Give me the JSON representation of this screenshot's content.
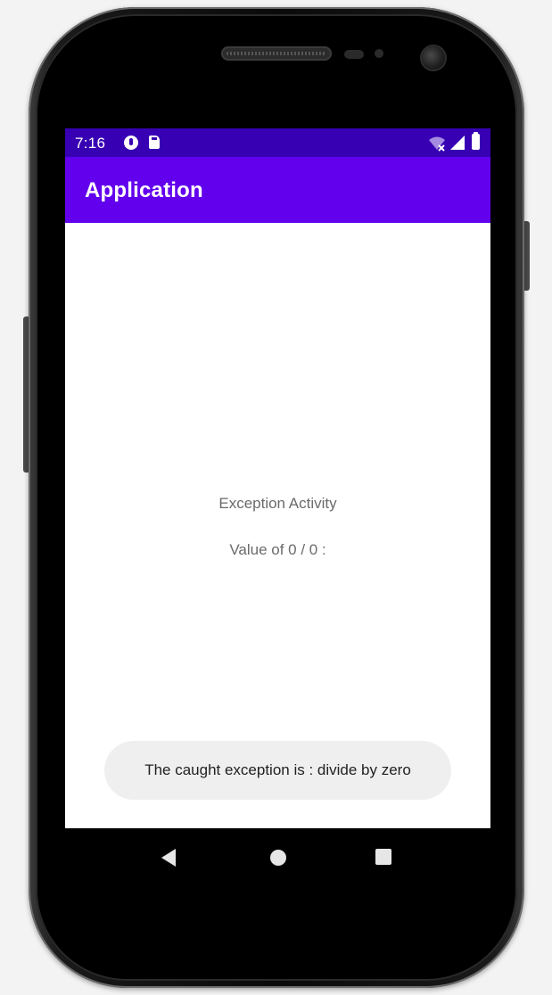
{
  "status_bar": {
    "time": "7:16",
    "icons": [
      "notification-icon",
      "sd-card-icon",
      "wifi-icon",
      "signal-icon",
      "battery-icon"
    ]
  },
  "app_bar": {
    "title": "Application",
    "color": "#6200ee",
    "status_color": "#3700b3"
  },
  "content": {
    "title": "Exception Activity",
    "value_label": "Value of 0 / 0 :"
  },
  "toast": {
    "message": "The caught exception is : divide by zero"
  },
  "nav_bar": {
    "buttons": [
      "back-icon",
      "home-icon",
      "recents-icon"
    ]
  }
}
